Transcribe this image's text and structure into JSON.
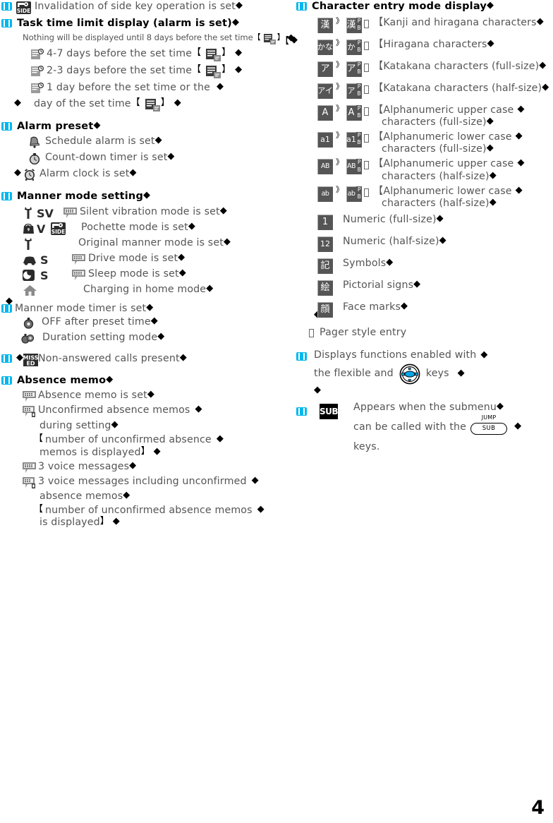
{
  "page": {
    "number": "4"
  },
  "left_column": {
    "sections": [
      {
        "type": "bulleted-icon-line",
        "bullet": true,
        "icon": "side-key-lock-icon",
        "text": "Invalidation of side key operation is set",
        "trailing_marker": "◆"
      },
      {
        "type": "heading",
        "bullet": true,
        "text": "Task time limit display (alarm is set)",
        "trailing_marker": "◆"
      },
      {
        "type": "note",
        "text": "Nothing will be displayed until 8 days before the set time",
        "box1": "【",
        "icon": "task-doc-icon",
        "box2": "】",
        "trailing_marker": "◆"
      },
      {
        "type": "icon-line",
        "icon": "task-clock-icon",
        "text": "4-7 days before the set time",
        "box1": "【",
        "icon2": "task-doc-icon",
        "box2": "】",
        "trailing_marker": "◆"
      },
      {
        "type": "icon-line",
        "icon": "task-clock-icon",
        "text": "2-3 days before the set time",
        "box1": "【",
        "icon2": "task-doc-icon",
        "box2": "】",
        "trailing_marker": "◆"
      },
      {
        "type": "icon-line",
        "icon": "task-clock-icon",
        "text": "1 day before the set time or the",
        "trailing_marker": "◆"
      },
      {
        "type": "cont-line",
        "lead_marker": "◆",
        "text": "day of the set time",
        "box1": "【",
        "icon2": "task-doc-icon",
        "box2": "】",
        "trailing_marker": "◆"
      },
      {
        "type": "heading",
        "bullet": true,
        "text": "Alarm preset",
        "trailing_marker": "◆"
      },
      {
        "type": "icon-line",
        "icon": "schedule-bell-icon",
        "text": "Schedule alarm is set",
        "trailing_marker": "◆"
      },
      {
        "type": "icon-line",
        "icon": "countdown-timer-icon",
        "text": "Count-down timer is set",
        "trailing_marker": "◆"
      },
      {
        "type": "icon-line",
        "lead_marker": "◆",
        "icon": "alarm-clock-icon",
        "text": "Alarm clock is set",
        "trailing_marker": "◆"
      },
      {
        "type": "heading",
        "bullet": true,
        "text": "Manner mode setting",
        "trailing_marker": "◆"
      },
      {
        "type": "manner-line",
        "icons": [
          "manner-key-icon",
          "sv-vibration-icon"
        ],
        "icon3": "memo-balloon-icon",
        "text": "Silent vibration mode is set",
        "trailing_marker": "◆"
      },
      {
        "type": "manner-line",
        "icons": [
          "pochette-bag-icon",
          "vibration-v-icon",
          "side-key-lock-icon"
        ],
        "text": "Pochette mode is set",
        "trailing_marker": "◆"
      },
      {
        "type": "manner-line",
        "icons": [
          "manner-key-icon"
        ],
        "text": "Original manner mode is set",
        "trailing_marker": "◆"
      },
      {
        "type": "manner-line",
        "icons": [
          "drive-car-icon",
          "silent-s-icon"
        ],
        "icon3": "memo-balloon-icon",
        "text": "Drive mode is set",
        "trailing_marker": "◆"
      },
      {
        "type": "manner-line",
        "icons": [
          "sleep-moon-icon",
          "silent-s-icon"
        ],
        "icon3": "memo-balloon-icon",
        "text": "Sleep mode is set",
        "trailing_marker": "◆"
      },
      {
        "type": "manner-line",
        "icons": [
          "home-charging-icon"
        ],
        "text": "Charging in home mode",
        "trailing_marker": "◆"
      },
      {
        "type": "heading",
        "bullet": true,
        "lead_marker": "◆",
        "text": "Manner mode timer is set",
        "trailing_marker": "◆",
        "regular": true
      },
      {
        "type": "icon-line",
        "icon": "timer-off-icon",
        "text": "OFF after preset time",
        "trailing_marker": "◆"
      },
      {
        "type": "icon-line",
        "icon": "duration-setting-icon",
        "text": "Duration setting mode",
        "trailing_marker": "◆"
      },
      {
        "type": "bulleted-icon-line",
        "bullet": true,
        "lead_marker": "◆",
        "icon": "missed-calls-icon",
        "text": "Non-answered calls present",
        "trailing_marker": "◆"
      },
      {
        "type": "heading",
        "bullet": true,
        "text": "Absence memo",
        "trailing_marker": "◆"
      },
      {
        "type": "icon-line",
        "icon": "memo-balloon-icon",
        "text": "Absence memo is set",
        "trailing_marker": "◆"
      },
      {
        "type": "icon-line",
        "icon": "memo-balloon-tag-icon",
        "text": "Unconfirmed absence memos",
        "trailing_marker": "◆"
      },
      {
        "type": "cont-line",
        "text": "during setting",
        "trailing_marker": "◆"
      },
      {
        "type": "paren-note",
        "box1": "【",
        "text": "number of unconfirmed absence",
        "trailing_marker": "◆"
      },
      {
        "type": "cont-note",
        "text": "memos is displayed",
        "box2": "】",
        "trailing_marker": "◆"
      },
      {
        "type": "icon-line",
        "icon": "memo-balloon-icon",
        "text": "3 voice messages",
        "trailing_marker": "◆"
      },
      {
        "type": "icon-line",
        "icon": "memo-balloon-tag-icon",
        "text": "3 voice messages including unconfirmed",
        "trailing_marker": "◆"
      },
      {
        "type": "cont-line",
        "text": "absence memos",
        "trailing_marker": "◆"
      },
      {
        "type": "paren-note",
        "box1": "【",
        "text": "number of unconfirmed absence memos",
        "trailing_marker": "◆"
      },
      {
        "type": "cont-note",
        "text": "is displayed",
        "box2": "】",
        "trailing_marker": "◆"
      }
    ]
  },
  "right_column": {
    "heading": {
      "text": "Character entry mode display",
      "trailing_marker": "◆"
    },
    "stray_marker_left": "【",
    "stray_marker": "◆",
    "entry_modes": [
      {
        "tile1": "漢",
        "tile2": "漢",
        "pb": "PB",
        "text_lines": [
          "【Kanji and hiragana characters"
        ],
        "trailing_marker": "◆"
      },
      {
        "tile1": "かな",
        "tile2": "かな",
        "pb": "PB",
        "text_lines": [
          "【Hiragana characters"
        ],
        "trailing_marker": "◆"
      },
      {
        "tile1": "ア",
        "tile2": "ア",
        "pb": "PB",
        "text_lines": [
          "【Katakana characters (full-size)"
        ],
        "trailing_marker": "◆"
      },
      {
        "tile1": "アイ",
        "tile2": "アイ",
        "pb": "PB",
        "text_lines": [
          "【Katakana characters (half-size)"
        ],
        "trailing_marker": "◆"
      },
      {
        "tile1": "A",
        "tile2": "A",
        "pb": "PB",
        "text_lines": [
          "【Alphanumeric upper case",
          "characters (full-size)"
        ],
        "trailing_marker": "◆"
      },
      {
        "tile1": "a1",
        "tile2": "a1",
        "pb": "PB",
        "text_lines": [
          "【Alphanumeric lower case",
          "characters (full-size)"
        ],
        "trailing_marker": "◆"
      },
      {
        "tile1": "AB",
        "tile2": "AB",
        "pb": "PB",
        "text_lines": [
          "【Alphanumeric upper case",
          "characters (half-size)"
        ],
        "trailing_marker": "◆"
      },
      {
        "tile1": "ab",
        "tile2": "ab",
        "pb": "PB",
        "text_lines": [
          "【Alphanumeric lower case",
          "characters (half-size)"
        ],
        "trailing_marker": "◆"
      },
      {
        "tile1": "1",
        "text_lines": [
          "Numeric (full-size)"
        ],
        "trailing_marker": "◆"
      },
      {
        "tile1": "12",
        "text_lines": [
          "Numeric (half-size)"
        ],
        "trailing_marker": "◆"
      },
      {
        "tile1": "記",
        "text_lines": [
          "Symbols"
        ],
        "trailing_marker": "◆"
      },
      {
        "tile1": "絵",
        "text_lines": [
          "Pictorial signs"
        ],
        "trailing_marker": "◆"
      },
      {
        "tile1": "顔",
        "text_lines": [
          "Face marks"
        ],
        "trailing_marker": "◆",
        "lead_marker": "◆"
      }
    ],
    "pager_note": {
      "box": "】",
      "text": "Pager style entry"
    },
    "flexible_keys": {
      "line1": "Displays functions enabled with",
      "line2_a": "the flexible and",
      "key_icon": "navigation-key-icon",
      "line2_b": "keys",
      "trailing_marker": "◆",
      "extra_marker": "◆"
    },
    "submenu": {
      "badge": "SUB",
      "line1": "Appears when the submenu",
      "line2_a": "can be called with the",
      "key_top": "JUMP",
      "key_label": "SUB",
      "line3": "keys.",
      "trailing_marker": "◆"
    }
  }
}
